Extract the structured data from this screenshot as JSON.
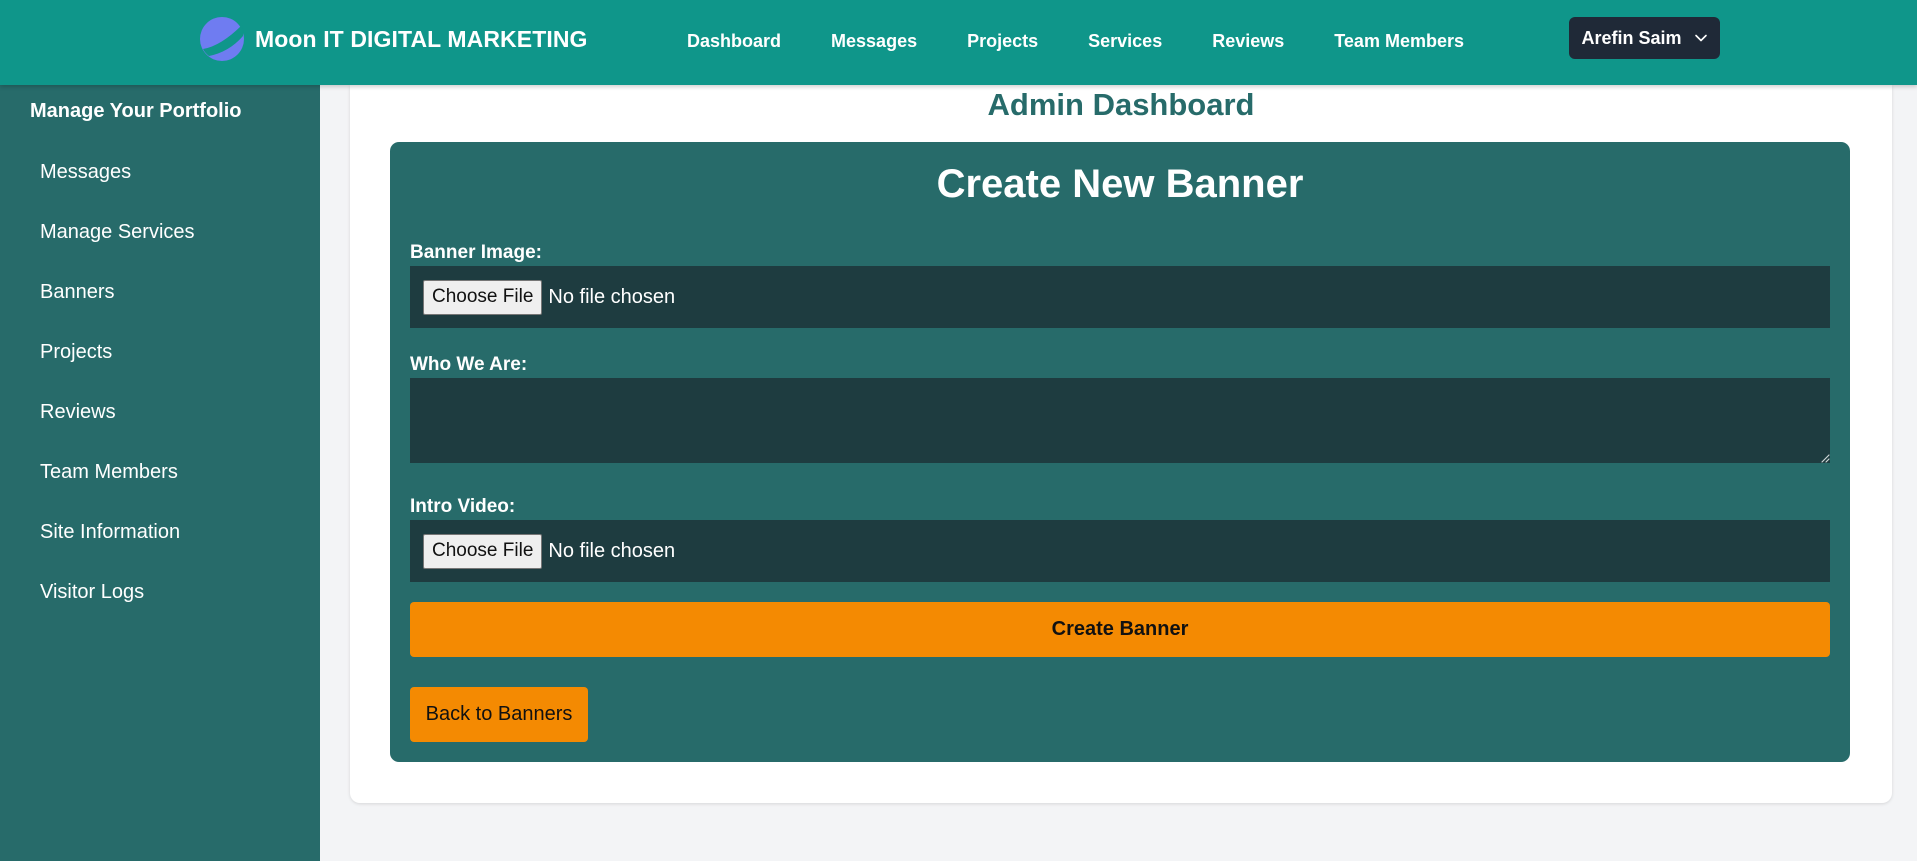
{
  "header": {
    "brand_name": "Moon IT DIGITAL MARKETING",
    "logo_icon": "moon-logo-icon",
    "nav": [
      "Dashboard",
      "Messages",
      "Projects",
      "Services",
      "Reviews",
      "Team Members"
    ],
    "user_label": "Arefin Saim",
    "user_icon": "chevron-down-icon"
  },
  "sidebar": {
    "title": "Manage Your Portfolio",
    "items": [
      "Messages",
      "Manage Services",
      "Banners",
      "Projects",
      "Reviews",
      "Team Members",
      "Site Information",
      "Visitor Logs"
    ]
  },
  "main": {
    "page_title": "Admin Dashboard",
    "form": {
      "title": "Create New Banner",
      "banner_image_label": "Banner Image:",
      "who_we_are_label": "Who We Are:",
      "who_we_are_value": "",
      "intro_video_label": "Intro Video:",
      "choose_file_label": "Choose File",
      "no_file_text": "No file chosen",
      "submit_label": "Create Banner",
      "back_label": "Back to Banners"
    }
  },
  "colors": {
    "navbar": "#0f968a",
    "sidebar": "#276b6a",
    "panel": "#276b6a",
    "input_bg": "#1e3c40",
    "accent_button": "#f48a02",
    "user_button": "#1f2937",
    "logo": "#6f7cf1"
  }
}
